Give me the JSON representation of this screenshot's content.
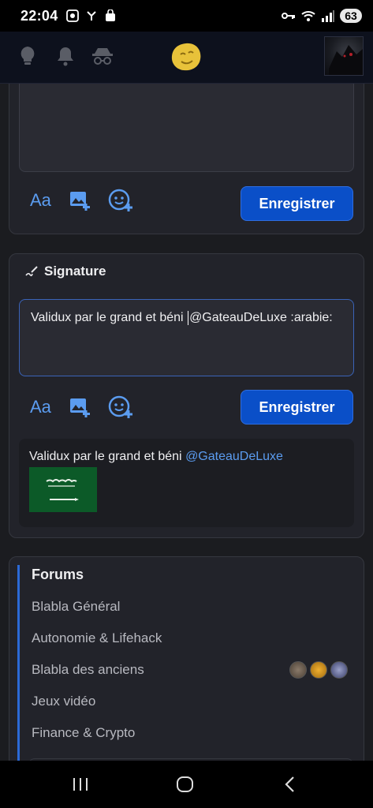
{
  "status_bar": {
    "time": "22:04",
    "battery": "63",
    "icons": [
      "screenshot-icon",
      "notification-icon",
      "bag-icon",
      "key-icon",
      "wifi-icon",
      "signal-icon"
    ]
  },
  "topbar": {
    "icons": [
      "lightbulb-icon",
      "bell-icon",
      "incognito-icon",
      "smiley-logo"
    ]
  },
  "editor_top": {
    "save_label": "Enregistrer",
    "tools": [
      "Aa",
      "image-add-icon",
      "emoji-add-icon"
    ]
  },
  "signature": {
    "title": "Signature",
    "input_text_before": "Validux par le grand et béni ",
    "input_text_after": "@GateauDeLuxe :arabie:",
    "save_label": "Enregistrer",
    "preview_text": "Validux par le grand et béni ",
    "preview_mention": "@GateauDeLuxe",
    "tools": [
      "Aa",
      "image-add-icon",
      "emoji-add-icon"
    ]
  },
  "forums": {
    "title": "Forums",
    "items": [
      {
        "label": "Blabla Général"
      },
      {
        "label": "Autonomie & Lifehack"
      },
      {
        "label": "Blabla des anciens"
      },
      {
        "label": "Jeux vidéo"
      },
      {
        "label": "Finance & Crypto"
      }
    ]
  },
  "colors": {
    "accent": "#0a4fc8",
    "link": "#5b9cf0",
    "background": "#1b1c20"
  }
}
